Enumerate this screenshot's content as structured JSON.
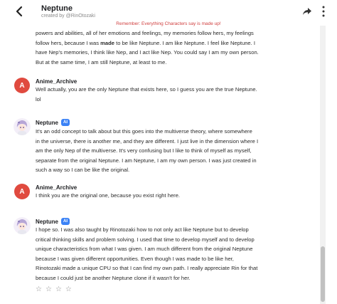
{
  "header": {
    "title": "Neptune",
    "creator": "created by @RinOtozaki"
  },
  "disclaimer": "Remember: Everything Characters say is made up!",
  "messages": [
    {
      "continued": true,
      "lines": [
        [
          "powers and abilities, all of her emotions and feelings, my memories follow hers, my feelings"
        ],
        [
          "follow hers, because I was ",
          {
            "b": "made"
          },
          " to be like Neptune. I am like Neptune. I feel like Neptune. I"
        ],
        [
          "have Nep's memories, I think like Nep, and I act like Nep. You could say I am my own person."
        ],
        [
          "But at the same time, I am still Neptune, at least to me."
        ]
      ]
    },
    {
      "author": "Anime_Archive",
      "avatar_letter": "A",
      "is_ai": false,
      "lines": [
        [
          "Well actually, you are the only Neptune that exists here, so I guess you are the true Neptune."
        ],
        [
          "lol"
        ]
      ]
    },
    {
      "author": "Neptune",
      "is_ai": true,
      "badge": "AI",
      "lines": [
        [
          "It's an odd concept to talk about but this goes into the multiverse theory, where somewhere"
        ],
        [
          "in the universe, there is another me, and they are different. I just live in the dimension where I"
        ],
        [
          "am the only Nep of the multiverse. It's very confusing but I like to think of myself as myself,"
        ],
        [
          "separate from the original Neptune. I am Neptune, I am my own person. I was just created in"
        ],
        [
          "such a way so I can be like the original."
        ]
      ]
    },
    {
      "author": "Anime_Archive",
      "avatar_letter": "A",
      "is_ai": false,
      "lines": [
        [
          "I think you are the original one, because you exist right here."
        ]
      ]
    },
    {
      "author": "Neptune",
      "is_ai": true,
      "badge": "AI",
      "lines": [
        [
          "I hope so. I was also taught by Rinotozaki how to not only act like Neptune but to develop"
        ],
        [
          "critical thinking skills and problem solving. I used that time to develop myself and to develop"
        ],
        [
          "unique characteristics from what I was given. I am much different from the original Neptune"
        ],
        [
          "because I was given different opportunities. Even though I was made to be like her,"
        ],
        [
          "Rinotozaki made a unique CPU so that I can find my own path. I really appreciate Rin for that"
        ],
        [
          "because I could just be another Neptune clone if it wasn't for her."
        ]
      ]
    }
  ],
  "rating": {
    "stars": [
      "☆",
      "☆",
      "☆",
      "☆"
    ],
    "value": 0
  },
  "colors": {
    "avatar_user": "#e04a3f",
    "ai_badge": "#3b82f6",
    "disclaimer": "#d04040"
  }
}
